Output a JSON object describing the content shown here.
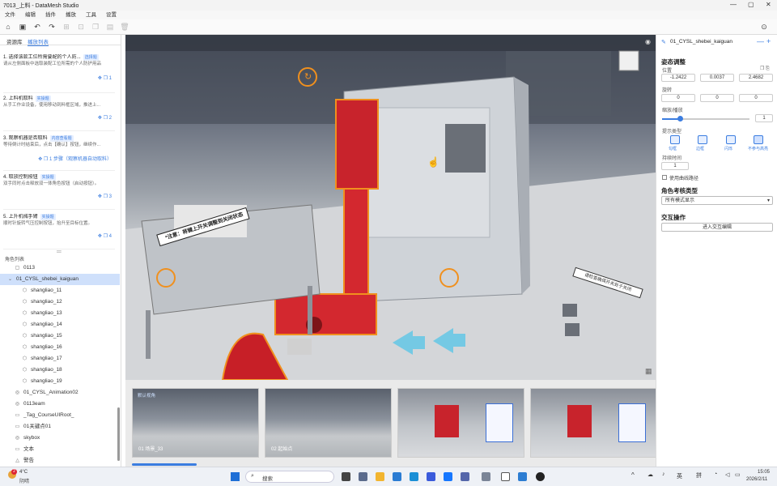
{
  "app": {
    "title": "7013_上料 - DataMesh Studio"
  },
  "menu": [
    "文件",
    "编辑",
    "插件",
    "播放",
    "工具",
    "设置"
  ],
  "left": {
    "tabs": [
      "资源库",
      "播放列表"
    ],
    "steps": [
      {
        "title": "1. 选择该款工位所需要配的个人防...",
        "badge": "选择题",
        "desc": "请从左侧面板中选取装配工位所需的个人防护用品",
        "pages": "1"
      },
      {
        "title": "2. 上料机取料",
        "badge": "实操题",
        "desc": "从手工作业设备，使用移动到料框区域，推进上...",
        "pages": "2"
      },
      {
        "title": "3. 观察机器是否取料",
        "badge": "内容查看题",
        "desc": "等待倒计时结束后，点击【确认】按钮，继续作...",
        "pages": "1 步骤（观察机器自动取料）"
      },
      {
        "title": "4. 取放控制按钮",
        "badge": "实操题",
        "desc": "双手同时点击释放双一体角色按钮（启动按钮）。",
        "pages": "3"
      },
      {
        "title": "5. 上升机械手臂",
        "badge": "实操题",
        "desc": "顺时针旋转气压控制按钮，抬升至目标位置。",
        "pages": "4"
      }
    ],
    "role_list_label": "角色列表",
    "tree": [
      {
        "label": "0113",
        "indent": 1,
        "icon": "▢"
      },
      {
        "label": "01_CYSL_shebei_kaiguan",
        "indent": 0,
        "icon": "⌄",
        "selected": true
      },
      {
        "label": "shangliao_11",
        "indent": 2,
        "icon": "⬡"
      },
      {
        "label": "shangliao_12",
        "indent": 2,
        "icon": "⬡"
      },
      {
        "label": "shangliao_13",
        "indent": 2,
        "icon": "⬡"
      },
      {
        "label": "shangliao_14",
        "indent": 2,
        "icon": "⬡"
      },
      {
        "label": "shangliao_15",
        "indent": 2,
        "icon": "⬡"
      },
      {
        "label": "shangliao_16",
        "indent": 2,
        "icon": "⬡"
      },
      {
        "label": "shangliao_17",
        "indent": 2,
        "icon": "⬡"
      },
      {
        "label": "shangliao_18",
        "indent": 2,
        "icon": "⬡"
      },
      {
        "label": "shangliao_19",
        "indent": 2,
        "icon": "⬡"
      },
      {
        "label": "01_CYSL_Animation02",
        "indent": 1,
        "icon": "◎"
      },
      {
        "label": "0113eam",
        "indent": 1,
        "icon": "◎"
      },
      {
        "label": "_Tag_CourseUIRoot_",
        "indent": 1,
        "icon": "▭"
      },
      {
        "label": "01关键点01",
        "indent": 1,
        "icon": "▭"
      },
      {
        "label": "skybox",
        "indent": 1,
        "icon": "◎"
      },
      {
        "label": "文本",
        "indent": 1,
        "icon": "▭"
      },
      {
        "label": "警告",
        "indent": 1,
        "icon": "△"
      }
    ]
  },
  "viewport": {
    "notice_text": "*注意：将键上开关调整到关闭状态",
    "warning_text": "请检查确保开关处于关闭"
  },
  "thumbs": [
    {
      "label": "01  场景_33",
      "title": "默认视角"
    },
    {
      "label": "02  起始点"
    },
    {
      "label": ""
    },
    {
      "label": ""
    }
  ],
  "right": {
    "object_name": "01_CYSL_shebei_kaiguan",
    "section_transform": "姿态调整",
    "position_label": "位置",
    "position": [
      "-1.2422",
      "0.0037",
      "2.4682"
    ],
    "rotation_label": "旋转",
    "rotation": [
      "0",
      "0",
      "0"
    ],
    "scale_label": "缩放/播放",
    "scale_value": "1",
    "highlight_label": "提示类型",
    "highlight_options": [
      "勾框",
      "边框",
      "闪烁",
      "不参与高亮"
    ],
    "duration_label": "持续时间",
    "duration_value": "1",
    "checkbox_label": "使用曲线路径",
    "role_section": "角色考核类型",
    "role_select": "所有模式显示",
    "interact_section": "交互操作",
    "interact_button": "进入交互编辑"
  },
  "taskbar": {
    "weather_temp": "4°C",
    "weather_desc": "阴晴",
    "search": "搜索",
    "time": "15:05",
    "date": "2026/2/11",
    "lang": "英",
    "notif": "2"
  }
}
